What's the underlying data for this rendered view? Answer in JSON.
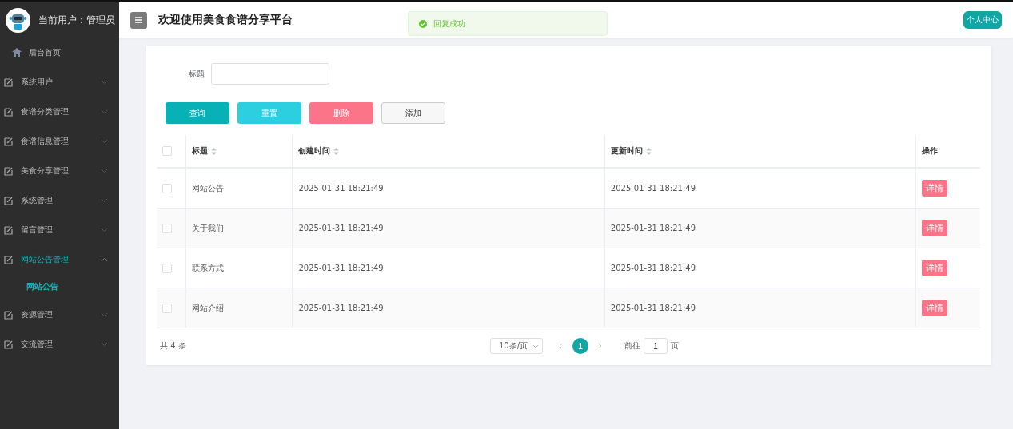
{
  "sidebar": {
    "user_label": "当前用户：",
    "user_name": "管理员",
    "items": [
      {
        "kind": "home",
        "label": "后台首页",
        "selected": false
      },
      {
        "kind": "group",
        "label": "系统用户",
        "selected": false,
        "expanded": false
      },
      {
        "kind": "group",
        "label": "食谱分类管理",
        "selected": false,
        "expanded": false
      },
      {
        "kind": "group",
        "label": "食谱信息管理",
        "selected": false,
        "expanded": false
      },
      {
        "kind": "group",
        "label": "美食分享管理",
        "selected": false,
        "expanded": false
      },
      {
        "kind": "group",
        "label": "系统管理",
        "selected": false,
        "expanded": false
      },
      {
        "kind": "group",
        "label": "留言管理",
        "selected": false,
        "expanded": false
      },
      {
        "kind": "group",
        "label": "网站公告管理",
        "selected": true,
        "expanded": true,
        "children": [
          {
            "label": "网站公告",
            "selected": true
          }
        ]
      },
      {
        "kind": "group",
        "label": "资源管理",
        "selected": false,
        "expanded": false
      },
      {
        "kind": "group",
        "label": "交流管理",
        "selected": false,
        "expanded": false
      }
    ]
  },
  "header": {
    "title": "欢迎使用美食食谱分享平台",
    "user_button": "个人中心"
  },
  "toast": {
    "kind": "success",
    "message": "回复成功"
  },
  "search": {
    "label": "标题"
  },
  "buttons": [
    {
      "kind": "primary",
      "label": "查询"
    },
    {
      "kind": "info",
      "label": "重置"
    },
    {
      "kind": "danger",
      "label": "删除"
    },
    {
      "kind": "plain",
      "label": "添加"
    }
  ],
  "table": {
    "header_checked": false,
    "columns": [
      {
        "label": "标题",
        "sortable": true
      },
      {
        "label": "创建时间",
        "sortable": true
      },
      {
        "label": "更新时间",
        "sortable": true
      },
      {
        "label": "操作",
        "sortable": false
      }
    ],
    "rows": [
      {
        "checked": false,
        "cells": [
          "网站公告",
          "2025-01-31 18:21:49",
          "2025-01-31 18:21:49"
        ],
        "action": "详情"
      },
      {
        "checked": false,
        "cells": [
          "关于我们",
          "2025-01-31 18:21:49",
          "2025-01-31 18:21:49"
        ],
        "action": "详情"
      },
      {
        "checked": false,
        "cells": [
          "联系方式",
          "2025-01-31 18:21:49",
          "2025-01-31 18:21:49"
        ],
        "action": "详情"
      },
      {
        "checked": false,
        "cells": [
          "网站介绍",
          "2025-01-31 18:21:49",
          "2025-01-31 18:21:49"
        ],
        "action": "详情"
      }
    ]
  },
  "pagination": {
    "total": "共 4 条",
    "page_size": "10条/页",
    "pages": [
      {
        "label": "1",
        "selected": true
      }
    ],
    "goto_label": "前往",
    "goto_value": "1",
    "goto_suffix": "页"
  }
}
